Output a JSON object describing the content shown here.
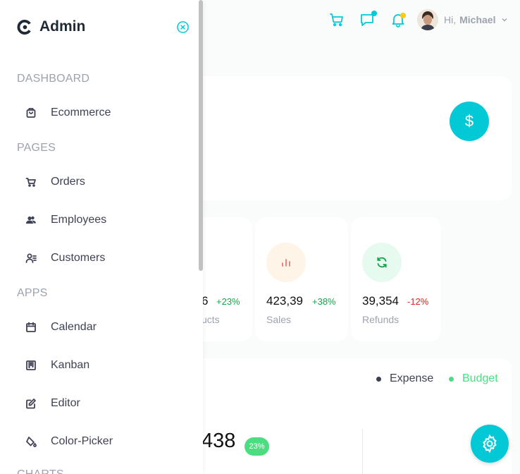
{
  "sidebar": {
    "logo_text": "Admin",
    "sections": [
      "DASHBOARD",
      "PAGES",
      "APPS",
      "CHARTS"
    ],
    "items": [
      {
        "label": "Ecommerce",
        "icon": "shopping-bag-icon"
      },
      {
        "label": "Orders",
        "icon": "cart-icon"
      },
      {
        "label": "Employees",
        "icon": "users-icon"
      },
      {
        "label": "Customers",
        "icon": "customer-list-icon"
      },
      {
        "label": "Calendar",
        "icon": "calendar-icon"
      },
      {
        "label": "Kanban",
        "icon": "kanban-icon"
      },
      {
        "label": "Editor",
        "icon": "edit-icon"
      },
      {
        "label": "Color-Picker",
        "icon": "paint-bucket-icon"
      }
    ]
  },
  "header": {
    "greeting": "Hi,",
    "user_name": "Michael",
    "notification_dot_color": "#fec90f",
    "chat_dot_color": "#03c9d7"
  },
  "stats": [
    {
      "amount": "6",
      "change": "+23%",
      "label": "ucts",
      "change_color": "#16a34a"
    },
    {
      "amount": "423,39",
      "change": "+38%",
      "label": "Sales",
      "change_color": "#16a34a"
    },
    {
      "amount": "39,354",
      "change": "-12%",
      "label": "Refunds",
      "change_color": "#dc2626"
    }
  ],
  "revenue": {
    "legend_expense": "Expense",
    "legend_budget": "Budget",
    "value": "438",
    "badge": "23%"
  },
  "colors": {
    "accent": "#03c9d7",
    "budget": "#4ade80"
  }
}
